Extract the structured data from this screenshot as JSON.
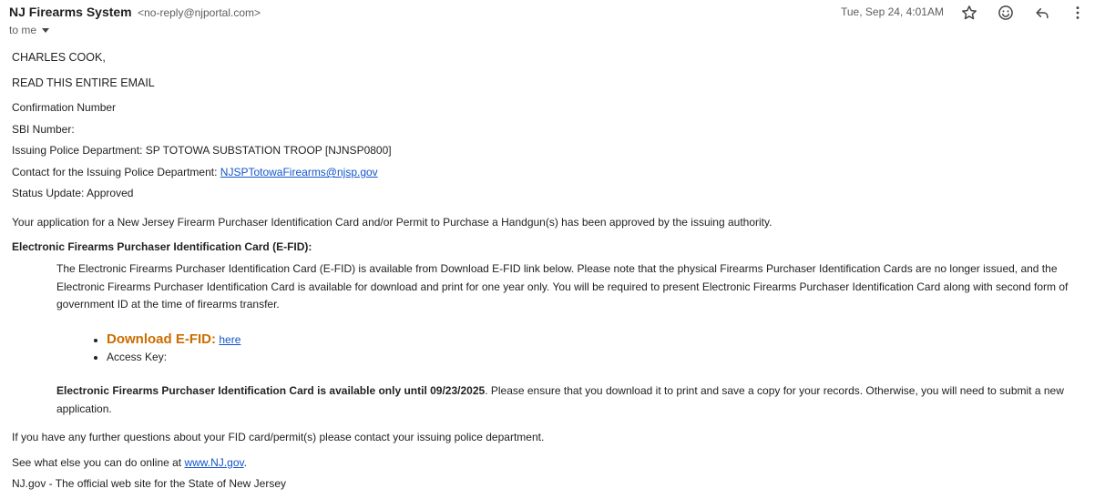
{
  "email": {
    "sender_name": "NJ Firearms System",
    "sender_email": "<no-reply@njportal.com>",
    "to_label": "to me",
    "timestamp": "Tue, Sep 24, 4:01AM",
    "actions": {
      "star": "star-icon",
      "emoji": "emoji-icon",
      "reply": "reply-icon",
      "more": "more-vert-icon"
    }
  },
  "body": {
    "greeting": "CHARLES COOK,",
    "read_notice": "READ THIS ENTIRE EMAIL",
    "confirmation_label": "Confirmation Number",
    "sbi_label": "SBI Number:",
    "issuing_dept": "Issuing Police Department: SP TOTOWA SUBSTATION TROOP [NJNSP0800]",
    "contact_label": "Contact for the Issuing Police Department: ",
    "contact_email": "NJSPTotowaFirearms@njsp.gov",
    "status_update": "Status Update: Approved",
    "approval_text": "Your application for a New Jersey Firearm Purchaser Identification Card and/or Permit to Purchase a Handgun(s) has been approved by the issuing authority.",
    "efid_heading": "Electronic Firearms Purchaser Identification Card (E-FID):",
    "efid_paragraph": "The Electronic Firearms Purchaser Identification Card (E-FID) is available from Download E-FID link below. Please note that the physical Firearms Purchaser Identification Cards are no longer issued, and the Electronic Firearms Purchaser Identification Card is available for download and print for one year only. You will be required to present Electronic Firearms Purchaser Identification Card along with second form of government ID at the time of firearms transfer.",
    "download_label": "Download E-FID:",
    "download_link": "here",
    "access_key_label": "Access Key:",
    "availability_bold": "Electronic Firearms Purchaser Identification Card is available only until 09/23/2025",
    "availability_rest": ". Please ensure that you download it to print and save a copy for your records. Otherwise, you will need to submit a new application.",
    "questions_text": "If you have any further questions about your FID card/permit(s) please contact your issuing police department.",
    "see_more_prefix": "See what else you can do online at ",
    "see_more_link": "www.NJ.gov",
    "see_more_suffix": ".",
    "footer": "NJ.gov - The official web site for the State of New Jersey"
  }
}
